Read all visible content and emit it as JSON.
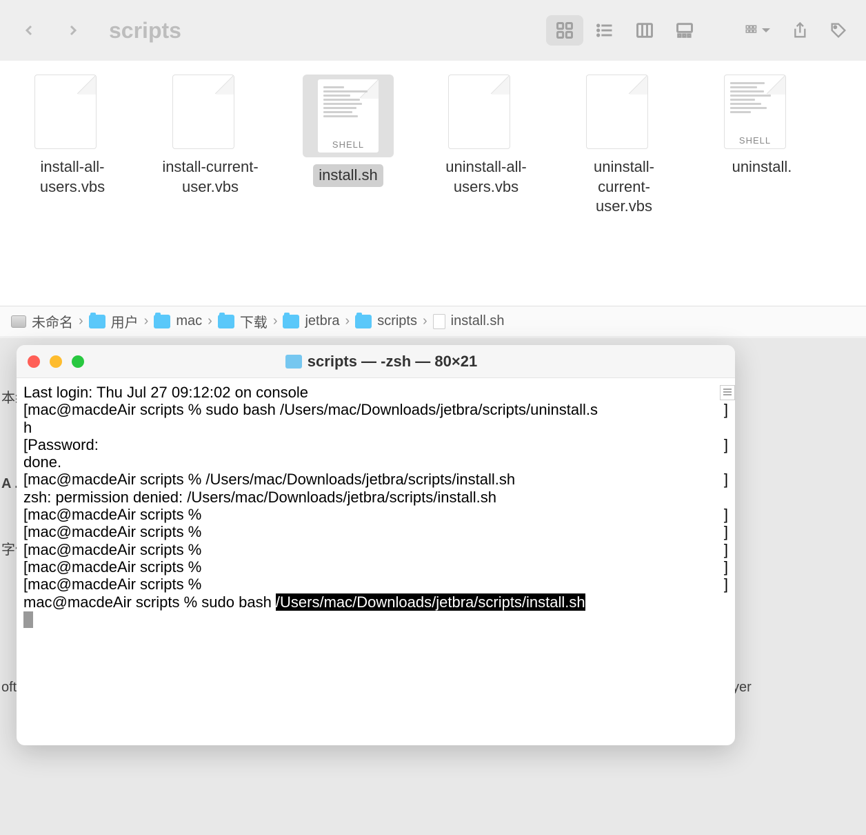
{
  "finder": {
    "title": "scripts",
    "files": [
      {
        "name": "install-all-users.vbs",
        "type": "doc",
        "selected": false
      },
      {
        "name": "install-current-user.vbs",
        "type": "doc",
        "selected": false
      },
      {
        "name": "install.sh",
        "type": "shell",
        "selected": true
      },
      {
        "name": "uninstall-all-users.vbs",
        "type": "doc",
        "selected": false
      },
      {
        "name": "uninstall-current-user.vbs",
        "type": "doc",
        "selected": false
      },
      {
        "name": "uninstall.",
        "type": "shell",
        "selected": false
      }
    ],
    "path": [
      {
        "label": "未命名",
        "icon": "disk"
      },
      {
        "label": "用户",
        "icon": "folder"
      },
      {
        "label": "mac",
        "icon": "folder"
      },
      {
        "label": "下载",
        "icon": "folder"
      },
      {
        "label": "jetbra",
        "icon": "folder"
      },
      {
        "label": "scripts",
        "icon": "folder"
      },
      {
        "label": "install.sh",
        "icon": "file"
      }
    ],
    "shell_label": "SHELL"
  },
  "terminal": {
    "title": "scripts — -zsh — 80×21",
    "lines": [
      {
        "text": "Last login: Thu Jul 27 09:12:02 on console"
      },
      {
        "prefix": "[",
        "text": "mac@macdeAir scripts % sudo bash /Users/mac/Downloads/jetbra/scripts/uninstall.s",
        "suffix": "]"
      },
      {
        "text": "h"
      },
      {
        "prefix": "[",
        "text": "Password:",
        "suffix": "]"
      },
      {
        "text": "done."
      },
      {
        "prefix": "[",
        "text": "mac@macdeAir scripts % /Users/mac/Downloads/jetbra/scripts/install.sh",
        "suffix": "]"
      },
      {
        "text": "zsh: permission denied: /Users/mac/Downloads/jetbra/scripts/install.sh"
      },
      {
        "prefix": "[",
        "text": "mac@macdeAir scripts % ",
        "suffix": "]"
      },
      {
        "prefix": "[",
        "text": "mac@macdeAir scripts % ",
        "suffix": "]"
      },
      {
        "prefix": "[",
        "text": "mac@macdeAir scripts % ",
        "suffix": "]"
      },
      {
        "prefix": "[",
        "text": "mac@macdeAir scripts % ",
        "suffix": "]"
      },
      {
        "prefix": "[",
        "text": "mac@macdeAir scripts % ",
        "suffix": "]"
      },
      {
        "text": "mac@macdeAir scripts % sudo bash ",
        "highlighted": "/Users/mac/Downloads/jetbra/scripts/install.sh"
      }
    ]
  },
  "bg": {
    "t1": "本纤",
    "t2": "A .",
    "t3": "字体",
    "t4": "oft",
    "t5": "yer"
  }
}
